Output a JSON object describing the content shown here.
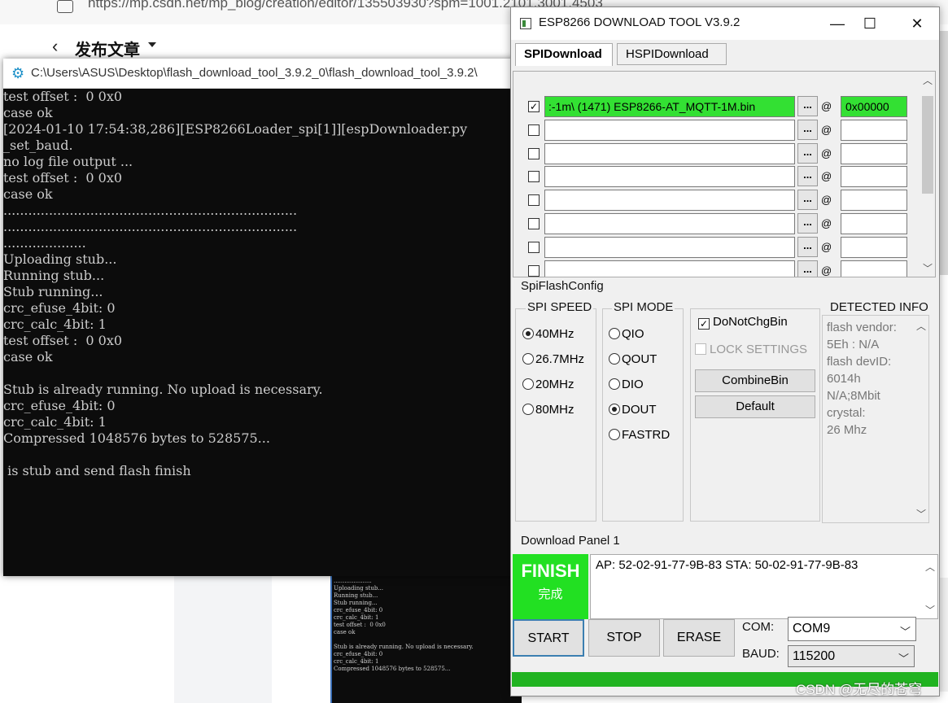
{
  "browser": {
    "url": "https://mp.csdn.net/mp_blog/creation/editor/135503930?spm=1001.2101.3001.4503",
    "page_title": "发布文章",
    "back_icon": "chevron-left-icon",
    "bottom_terminal": ".....................\nUploading stub...\nRunning stub...\nStub running...\ncrc_efuse_4bit: 0\ncrc_calc_4bit: 1\ntest offset :  0 0x0\ncase ok\n\nStub is already running. No upload is necessary.\ncrc_efuse_4bit: 0\ncrc_calc_4bit: 1\nCompressed 1048576 bytes to 528575..."
  },
  "console": {
    "icon": "gear-icon",
    "title": "C:\\Users\\ASUS\\Desktop\\flash_download_tool_3.9.2_0\\flash_download_tool_3.9.2\\",
    "output": "test offset :  0 0x0\ncase ok\n[2024-01-10 17:54:38,286][ESP8266Loader_spi[1]][espDownloader.py\n_set_baud.\nno log file output ...\ntest offset :  0 0x0\ncase ok\n.......................................................................\n.......................................................................\n....................\nUploading stub...\nRunning stub...\nStub running...\ncrc_efuse_4bit: 0\ncrc_calc_4bit: 1\ntest offset :  0 0x0\ncase ok\n\nStub is already running. No upload is necessary.\ncrc_efuse_4bit: 0\ncrc_calc_4bit: 1\nCompressed 1048576 bytes to 528575...\n\n is stub and send flash finish"
  },
  "tool": {
    "title": "ESP8266 DOWNLOAD TOOL V3.9.2",
    "window_buttons": {
      "minimize": "—",
      "maximize": "☐",
      "close": "✕"
    },
    "tabs": [
      "SPIDownload",
      "HSPIDownload"
    ],
    "files": [
      {
        "checked": true,
        "path": ":-1m\\  (1471)  ESP8266-AT_MQTT-1M.bin",
        "browse": "...",
        "at": "@",
        "offset": "0x00000",
        "highlight": true
      },
      {
        "checked": false,
        "path": "",
        "browse": "...",
        "at": "@",
        "offset": "",
        "highlight": false
      },
      {
        "checked": false,
        "path": "",
        "browse": "...",
        "at": "@",
        "offset": "",
        "highlight": false
      },
      {
        "checked": false,
        "path": "",
        "browse": "...",
        "at": "@",
        "offset": "",
        "highlight": false
      },
      {
        "checked": false,
        "path": "",
        "browse": "...",
        "at": "@",
        "offset": "",
        "highlight": false
      },
      {
        "checked": false,
        "path": "",
        "browse": "...",
        "at": "@",
        "offset": "",
        "highlight": false
      },
      {
        "checked": false,
        "path": "",
        "browse": "...",
        "at": "@",
        "offset": "",
        "highlight": false
      },
      {
        "checked": false,
        "path": "",
        "browse": "...",
        "at": "@",
        "offset": "",
        "highlight": false
      }
    ],
    "spi_config": {
      "title": "SpiFlashConfig",
      "speed_title": "SPI SPEED",
      "speeds": [
        "40MHz",
        "26.7MHz",
        "20MHz",
        "80MHz"
      ],
      "speed_selected": "40MHz",
      "mode_title": "SPI MODE",
      "modes": [
        "QIO",
        "QOUT",
        "DIO",
        "DOUT",
        "FASTRD"
      ],
      "mode_selected": "DOUT",
      "do_not_chg_bin": "DoNotChgBin",
      "lock_settings": "LOCK SETTINGS",
      "combine_bin": "CombineBin",
      "default": "Default",
      "detected_title": "DETECTED INFO",
      "detected_text": "flash vendor:\n5Eh : N/A\nflash devID:\n6014h\nN/A;8Mbit\ncrystal:\n26 Mhz"
    },
    "download_panel": {
      "title": "Download Panel 1",
      "status_en": "FINISH",
      "status_cn": "完成",
      "mac_info": "AP:  52-02-91-77-9B-83   STA:  50-02-91-77-9B-83",
      "start": "START",
      "stop": "STOP",
      "erase": "ERASE",
      "com_label": "COM:",
      "com_value": "COM9",
      "baud_label": "BAUD:",
      "baud_value": "115200",
      "progress": 1.0
    }
  },
  "watermark": "CSDN @无尽的苍穹",
  "colors": {
    "finish_green": "#22e022",
    "progress_green": "#21b321",
    "highlight_green": "#33e033",
    "console_bg": "#0c0c0c"
  }
}
